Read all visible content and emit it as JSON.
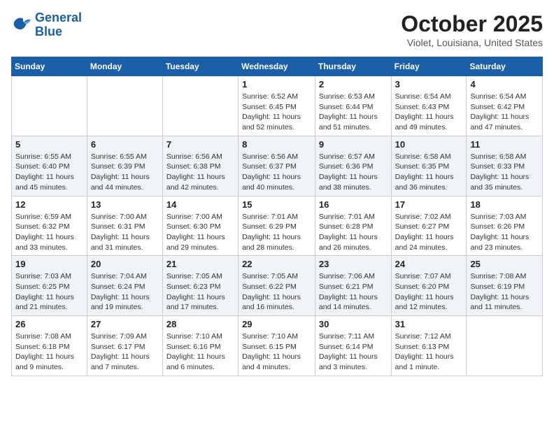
{
  "header": {
    "logo": {
      "line1": "General",
      "line2": "Blue"
    },
    "month": "October 2025",
    "location": "Violet, Louisiana, United States"
  },
  "weekdays": [
    "Sunday",
    "Monday",
    "Tuesday",
    "Wednesday",
    "Thursday",
    "Friday",
    "Saturday"
  ],
  "weeks": [
    [
      {
        "day": "",
        "info": ""
      },
      {
        "day": "",
        "info": ""
      },
      {
        "day": "",
        "info": ""
      },
      {
        "day": "1",
        "info": "Sunrise: 6:52 AM\nSunset: 6:45 PM\nDaylight: 11 hours\nand 52 minutes."
      },
      {
        "day": "2",
        "info": "Sunrise: 6:53 AM\nSunset: 6:44 PM\nDaylight: 11 hours\nand 51 minutes."
      },
      {
        "day": "3",
        "info": "Sunrise: 6:54 AM\nSunset: 6:43 PM\nDaylight: 11 hours\nand 49 minutes."
      },
      {
        "day": "4",
        "info": "Sunrise: 6:54 AM\nSunset: 6:42 PM\nDaylight: 11 hours\nand 47 minutes."
      }
    ],
    [
      {
        "day": "5",
        "info": "Sunrise: 6:55 AM\nSunset: 6:40 PM\nDaylight: 11 hours\nand 45 minutes."
      },
      {
        "day": "6",
        "info": "Sunrise: 6:55 AM\nSunset: 6:39 PM\nDaylight: 11 hours\nand 44 minutes."
      },
      {
        "day": "7",
        "info": "Sunrise: 6:56 AM\nSunset: 6:38 PM\nDaylight: 11 hours\nand 42 minutes."
      },
      {
        "day": "8",
        "info": "Sunrise: 6:56 AM\nSunset: 6:37 PM\nDaylight: 11 hours\nand 40 minutes."
      },
      {
        "day": "9",
        "info": "Sunrise: 6:57 AM\nSunset: 6:36 PM\nDaylight: 11 hours\nand 38 minutes."
      },
      {
        "day": "10",
        "info": "Sunrise: 6:58 AM\nSunset: 6:35 PM\nDaylight: 11 hours\nand 36 minutes."
      },
      {
        "day": "11",
        "info": "Sunrise: 6:58 AM\nSunset: 6:33 PM\nDaylight: 11 hours\nand 35 minutes."
      }
    ],
    [
      {
        "day": "12",
        "info": "Sunrise: 6:59 AM\nSunset: 6:32 PM\nDaylight: 11 hours\nand 33 minutes."
      },
      {
        "day": "13",
        "info": "Sunrise: 7:00 AM\nSunset: 6:31 PM\nDaylight: 11 hours\nand 31 minutes."
      },
      {
        "day": "14",
        "info": "Sunrise: 7:00 AM\nSunset: 6:30 PM\nDaylight: 11 hours\nand 29 minutes."
      },
      {
        "day": "15",
        "info": "Sunrise: 7:01 AM\nSunset: 6:29 PM\nDaylight: 11 hours\nand 28 minutes."
      },
      {
        "day": "16",
        "info": "Sunrise: 7:01 AM\nSunset: 6:28 PM\nDaylight: 11 hours\nand 26 minutes."
      },
      {
        "day": "17",
        "info": "Sunrise: 7:02 AM\nSunset: 6:27 PM\nDaylight: 11 hours\nand 24 minutes."
      },
      {
        "day": "18",
        "info": "Sunrise: 7:03 AM\nSunset: 6:26 PM\nDaylight: 11 hours\nand 23 minutes."
      }
    ],
    [
      {
        "day": "19",
        "info": "Sunrise: 7:03 AM\nSunset: 6:25 PM\nDaylight: 11 hours\nand 21 minutes."
      },
      {
        "day": "20",
        "info": "Sunrise: 7:04 AM\nSunset: 6:24 PM\nDaylight: 11 hours\nand 19 minutes."
      },
      {
        "day": "21",
        "info": "Sunrise: 7:05 AM\nSunset: 6:23 PM\nDaylight: 11 hours\nand 17 minutes."
      },
      {
        "day": "22",
        "info": "Sunrise: 7:05 AM\nSunset: 6:22 PM\nDaylight: 11 hours\nand 16 minutes."
      },
      {
        "day": "23",
        "info": "Sunrise: 7:06 AM\nSunset: 6:21 PM\nDaylight: 11 hours\nand 14 minutes."
      },
      {
        "day": "24",
        "info": "Sunrise: 7:07 AM\nSunset: 6:20 PM\nDaylight: 11 hours\nand 12 minutes."
      },
      {
        "day": "25",
        "info": "Sunrise: 7:08 AM\nSunset: 6:19 PM\nDaylight: 11 hours\nand 11 minutes."
      }
    ],
    [
      {
        "day": "26",
        "info": "Sunrise: 7:08 AM\nSunset: 6:18 PM\nDaylight: 11 hours\nand 9 minutes."
      },
      {
        "day": "27",
        "info": "Sunrise: 7:09 AM\nSunset: 6:17 PM\nDaylight: 11 hours\nand 7 minutes."
      },
      {
        "day": "28",
        "info": "Sunrise: 7:10 AM\nSunset: 6:16 PM\nDaylight: 11 hours\nand 6 minutes."
      },
      {
        "day": "29",
        "info": "Sunrise: 7:10 AM\nSunset: 6:15 PM\nDaylight: 11 hours\nand 4 minutes."
      },
      {
        "day": "30",
        "info": "Sunrise: 7:11 AM\nSunset: 6:14 PM\nDaylight: 11 hours\nand 3 minutes."
      },
      {
        "day": "31",
        "info": "Sunrise: 7:12 AM\nSunset: 6:13 PM\nDaylight: 11 hours\nand 1 minute."
      },
      {
        "day": "",
        "info": ""
      }
    ]
  ]
}
